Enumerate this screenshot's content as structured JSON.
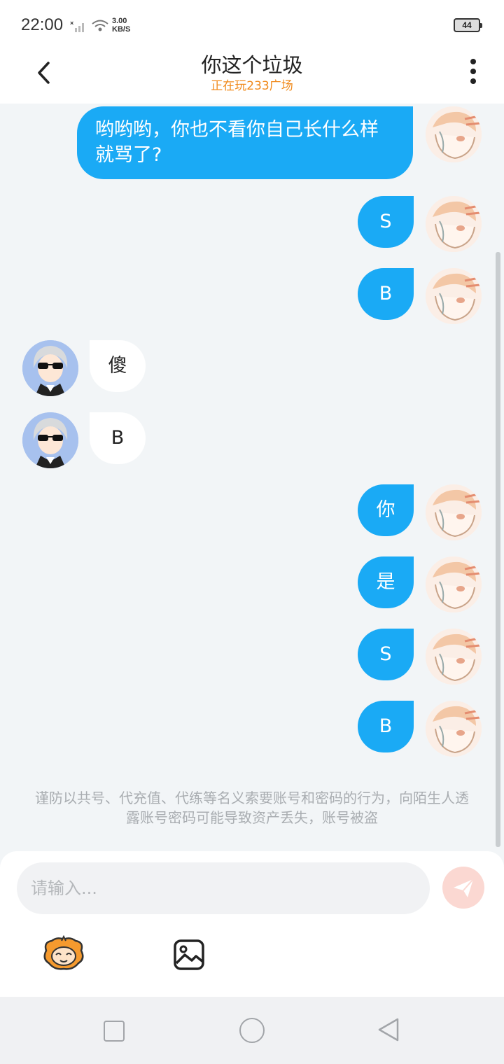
{
  "status_bar": {
    "time": "22:00",
    "network_speed_value": "3.00",
    "network_speed_unit": "KB/S",
    "battery": "44"
  },
  "header": {
    "title": "你这个垃圾",
    "subtitle": "正在玩233广场"
  },
  "messages": [
    {
      "from": "me",
      "text": "哟哟哟，你也不看你自己长什么样就骂了?"
    },
    {
      "from": "me",
      "text": "S"
    },
    {
      "from": "me",
      "text": "B"
    },
    {
      "from": "other",
      "text": "傻"
    },
    {
      "from": "other",
      "text": "B"
    },
    {
      "from": "me",
      "text": "你"
    },
    {
      "from": "me",
      "text": "是"
    },
    {
      "from": "me",
      "text": "S"
    },
    {
      "from": "me",
      "text": "B"
    }
  ],
  "safety_notice": "谨防以共号、代充值、代练等名义索要账号和密码的行为，向陌生人透露账号密码可能导致资产丢失，账号被盗",
  "composer": {
    "placeholder": "请输入..."
  },
  "icons": {
    "back": "chevron-left-icon",
    "more": "more-vertical-icon",
    "send": "send-icon",
    "emoji": "mascot-emoji-icon",
    "image": "image-icon"
  },
  "colors": {
    "accent": "#1aaaf5",
    "subtitle": "#f08a1c",
    "send_disabled": "#fbd8d2"
  }
}
